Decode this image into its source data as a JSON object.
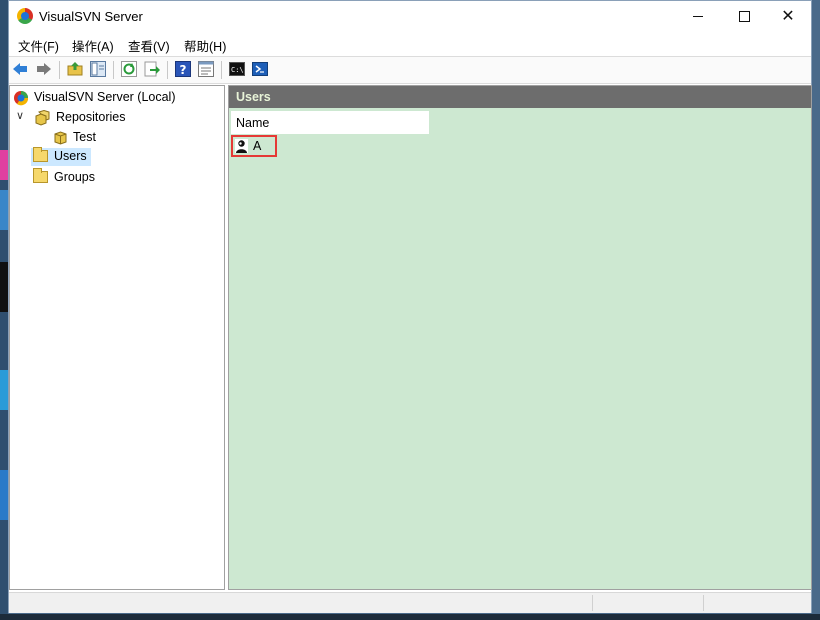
{
  "window": {
    "title": "VisualSVN Server"
  },
  "menu": [
    "文件(F)",
    "操作(A)",
    "查看(V)",
    "帮助(H)"
  ],
  "toolbar_icons": [
    "back-arrow-icon",
    "forward-arrow-icon",
    "up-folder-icon",
    "show-tree-icon",
    "refresh-icon",
    "export-icon",
    "help-icon",
    "properties-icon",
    "console-icon",
    "powershell-icon"
  ],
  "tree": {
    "root": "VisualSVN Server (Local)",
    "repositories": "Repositories",
    "repo_test": "Test",
    "users": "Users",
    "groups": "Groups"
  },
  "panel": {
    "title": "Users",
    "column_name": "Name",
    "rows": [
      {
        "name": "A"
      }
    ]
  },
  "colors": {
    "panel_bg": "#cde8d1",
    "header_bg": "#6d6d6d",
    "header_text": "#e8f4d8",
    "highlight": "#e53935",
    "selection": "#cce8ff"
  }
}
